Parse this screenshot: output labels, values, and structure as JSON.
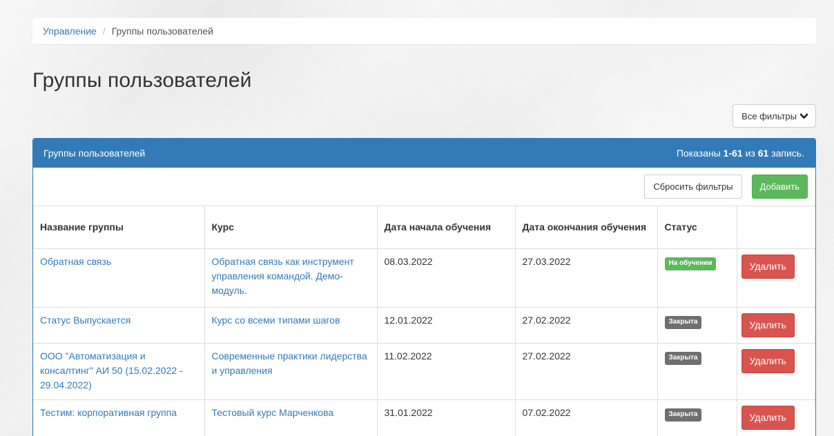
{
  "breadcrumb": {
    "root": "Управление",
    "separator": "/",
    "current": "Группы пользователей"
  },
  "page_title": "Группы пользователей",
  "filters_button": {
    "label": "Все фильтры",
    "icon": "chevron-down-icon"
  },
  "panel": {
    "title": "Группы пользователей",
    "summary_prefix": "Показаны ",
    "summary_range": "1-61",
    "summary_mid": " из ",
    "summary_total": "61",
    "summary_suffix": " запись."
  },
  "toolbar": {
    "reset_label": "Сбросить фильтры",
    "add_label": "Добавить"
  },
  "table": {
    "columns": [
      "Название группы",
      "Курс",
      "Дата начала обучения",
      "Дата окончания обучения",
      "Статус",
      ""
    ],
    "rows": [
      {
        "name": "Обратная связь",
        "course": "Обратная связь как инструмент управления командой. Демо-модуль.",
        "start": "08.03.2022",
        "end": "27.03.2022",
        "status": "На обучении",
        "status_type": "success",
        "action": "Удалить"
      },
      {
        "name": "Статус Выпускается",
        "course": "Курс со всеми типами шагов",
        "start": "12.01.2022",
        "end": "27.02.2022",
        "status": "Закрыта",
        "status_type": "default",
        "action": "Удалить"
      },
      {
        "name": "ООО \"Автоматизация и консалтинг\" АИ 50 (15.02.2022 - 29.04.2022)",
        "course": "Современные практики лидерства и управления",
        "start": "11.02.2022",
        "end": "27.02.2022",
        "status": "Закрыта",
        "status_type": "default",
        "action": "Удалить"
      },
      {
        "name": "Тестим: корпоративная группа",
        "course": "Тестовый курс Марченкова",
        "start": "31.01.2022",
        "end": "07.02.2022",
        "status": "Закрыта",
        "status_type": "default",
        "action": "Удалить"
      }
    ]
  },
  "colors": {
    "primary": "#337ab7",
    "success": "#5cb85c",
    "danger": "#d9534f",
    "closed": "#6f6f6f"
  }
}
